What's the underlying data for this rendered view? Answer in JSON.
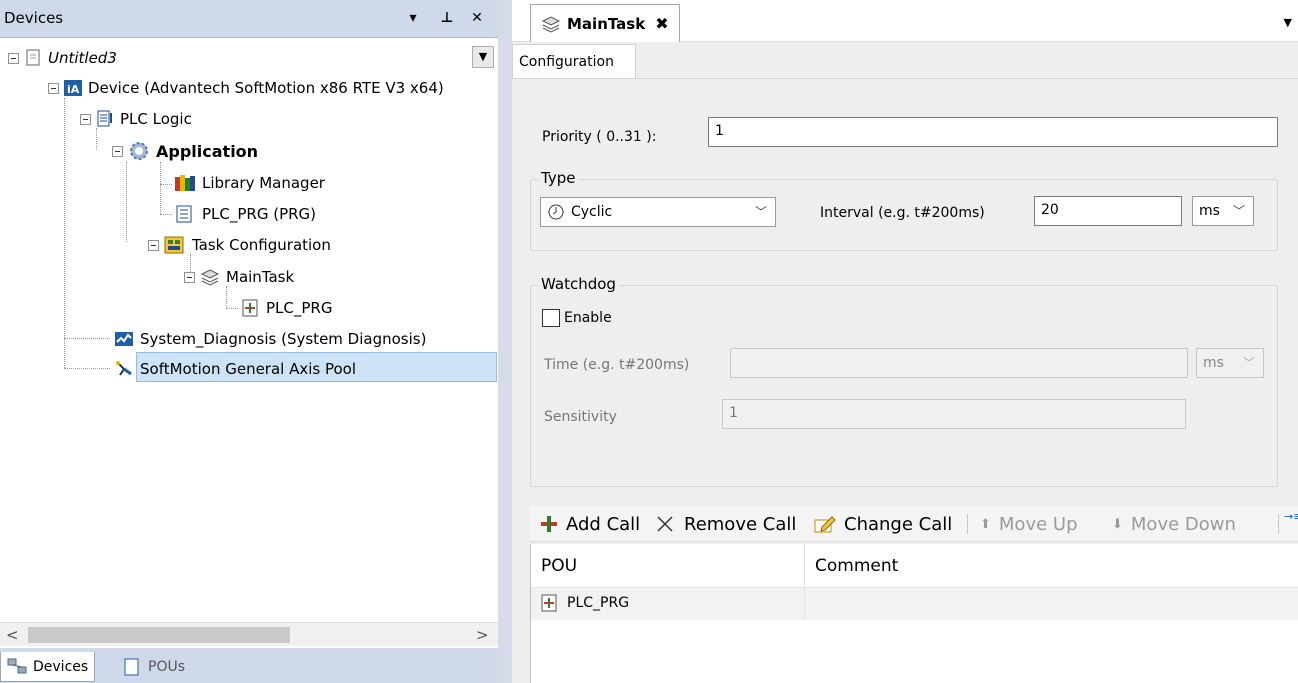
{
  "devices_panel": {
    "title": "Devices",
    "header_buttons": {
      "dropdown": "▾",
      "pin": "⊥",
      "close": "✕"
    }
  },
  "tree": {
    "project": "Untitled3",
    "device": "Device (Advantech SoftMotion x86 RTE V3 x64)",
    "plc_logic": "PLC Logic",
    "application": "Application",
    "library_manager": "Library Manager",
    "plc_prg_prg": "PLC_PRG (PRG)",
    "task_configuration": "Task Configuration",
    "main_task": "MainTask",
    "plc_prg": "PLC_PRG",
    "system_diagnosis": "System_Diagnosis (System Diagnosis)",
    "axis_pool": "SoftMotion General Axis Pool"
  },
  "bottom_tabs": [
    "Devices",
    "POUs"
  ],
  "editor": {
    "doc_tab": "MainTask",
    "sub_tab": "Configuration",
    "priority_label": "Priority ( 0..31 ):",
    "priority_value": "1",
    "type_group": "Type",
    "type_value": "Cyclic",
    "interval_label": "Interval (e.g. t#200ms)",
    "interval_value": "20",
    "interval_unit": "ms",
    "watchdog_group": "Watchdog",
    "enable_label": "Enable",
    "enable_checked": false,
    "time_label": "Time (e.g. t#200ms)",
    "time_value": "",
    "time_unit": "ms",
    "sensitivity_label": "Sensitivity",
    "sensitivity_value": "1"
  },
  "toolbar": {
    "add_call": "Add Call",
    "remove_call": "Remove Call",
    "change_call": "Change Call",
    "move_up": "Move Up",
    "move_down": "Move Down"
  },
  "pou_table": {
    "columns": [
      "POU",
      "Comment"
    ],
    "rows": [
      {
        "pou": "PLC_PRG",
        "comment": ""
      }
    ]
  },
  "colors": {
    "panel_header": "#cfd9ea",
    "selection": "#cde3f7",
    "editor_bg": "#eeeeee"
  }
}
